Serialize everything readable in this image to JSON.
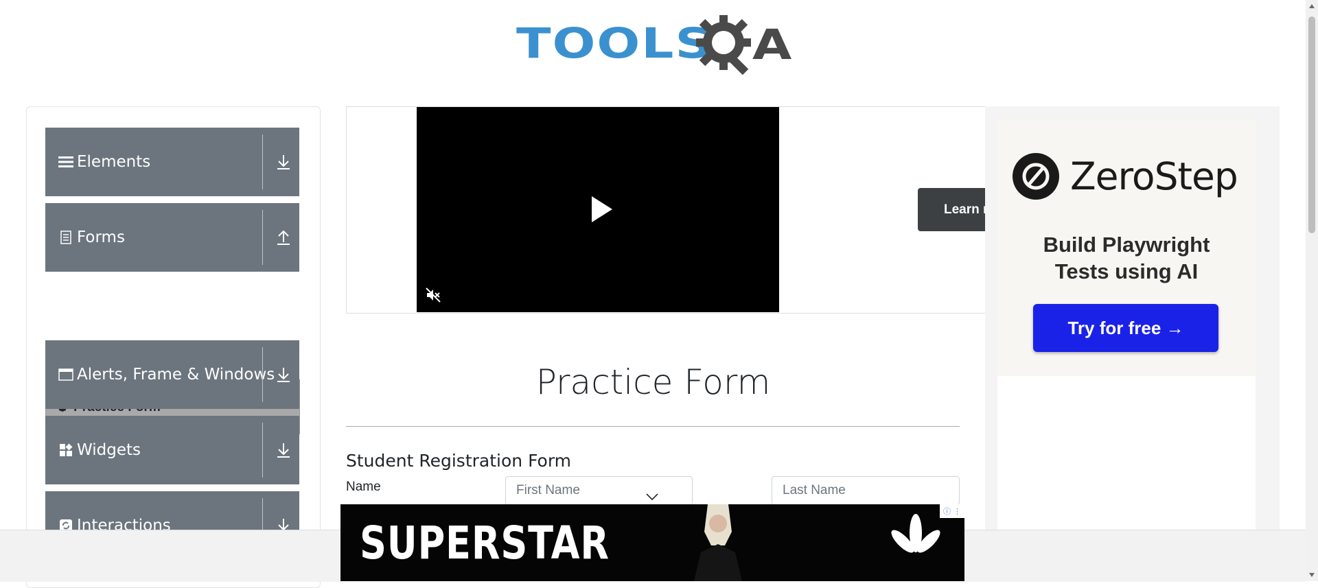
{
  "logo": {
    "text": "TOOLS",
    "letter": "A"
  },
  "sidebar": {
    "groups": [
      {
        "label": "Elements",
        "icon": "hamburger-icon",
        "arrow": "download-icon"
      },
      {
        "label": "Forms",
        "icon": "document-icon",
        "arrow": "upload-icon"
      },
      {
        "label": "Alerts, Frame & Windows",
        "icon": "window-icon",
        "arrow": "download-icon"
      },
      {
        "label": "Widgets",
        "icon": "widgets-icon",
        "arrow": "download-icon"
      },
      {
        "label": "Interactions",
        "icon": "refresh-icon",
        "arrow": "download-icon"
      }
    ],
    "active_item": {
      "label": "Practice Form",
      "icon": "html5-icon"
    }
  },
  "video_ad": {
    "button_label": "Learn m"
  },
  "right_ad": {
    "brand": "ZeroStep",
    "tagline_line1": "Build Playwright",
    "tagline_line2": "Tests using AI",
    "cta": "Try for free →",
    "cta_color": "#1b22e8"
  },
  "main": {
    "title": "Practice Form",
    "form_title": "Student Registration Form",
    "name_label": "Name",
    "first_name_placeholder": "First Name",
    "last_name_placeholder": "Last Name"
  },
  "bottom_banner": {
    "text": "SUPERSTAR",
    "info_glyph": "ⓘ",
    "menu_glyph": "⋮"
  },
  "colors": {
    "sidebar_group": "#6c757d",
    "sidebar_active": "#a9a9a9",
    "logo_blue": "#3b91cf"
  }
}
